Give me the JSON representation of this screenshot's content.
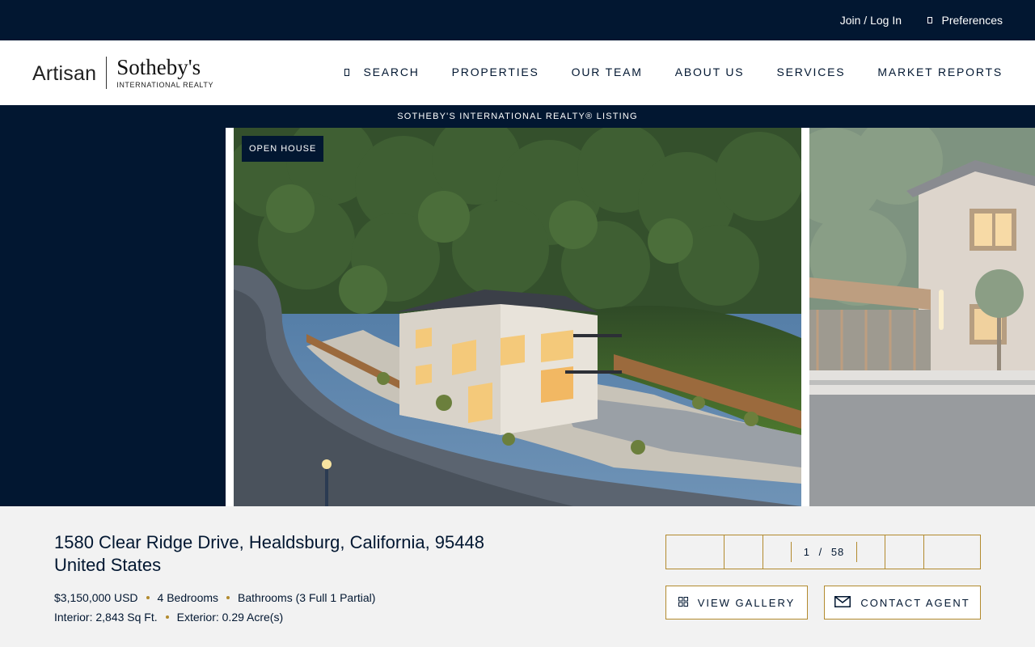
{
  "topbar": {
    "join_label": "Join / Log In",
    "preferences_label": "Preferences"
  },
  "logo": {
    "artisan": "Artisan",
    "sothebys": "Sotheby's",
    "subtitle": "INTERNATIONAL REALTY"
  },
  "nav": {
    "search": "SEARCH",
    "properties": "PROPERTIES",
    "our_team": "OUR TEAM",
    "about_us": "ABOUT US",
    "services": "SERVICES",
    "market_reports": "MARKET REPORTS"
  },
  "banner": {
    "text": "SOTHEBY'S INTERNATIONAL REALTY® LISTING"
  },
  "hero": {
    "badge": "OPEN HOUSE"
  },
  "listing": {
    "address_line1": "1580 Clear Ridge Drive, Healdsburg, California, 95448",
    "address_line2": "United States",
    "price": "$3,150,000 USD",
    "bedrooms": "4 Bedrooms",
    "bathrooms": "Bathrooms (3 Full 1 Partial)",
    "interior": "Interior: 2,843 Sq Ft.",
    "exterior": "Exterior: 0.29 Acre(s)"
  },
  "pager": {
    "current": "1",
    "separator": "/",
    "total": "58"
  },
  "buttons": {
    "view_gallery": "VIEW GALLERY",
    "contact_agent": "CONTACT AGENT"
  },
  "colors": {
    "navy": "#021731",
    "gold": "#b28a2e",
    "panel": "#f2f2f2"
  }
}
